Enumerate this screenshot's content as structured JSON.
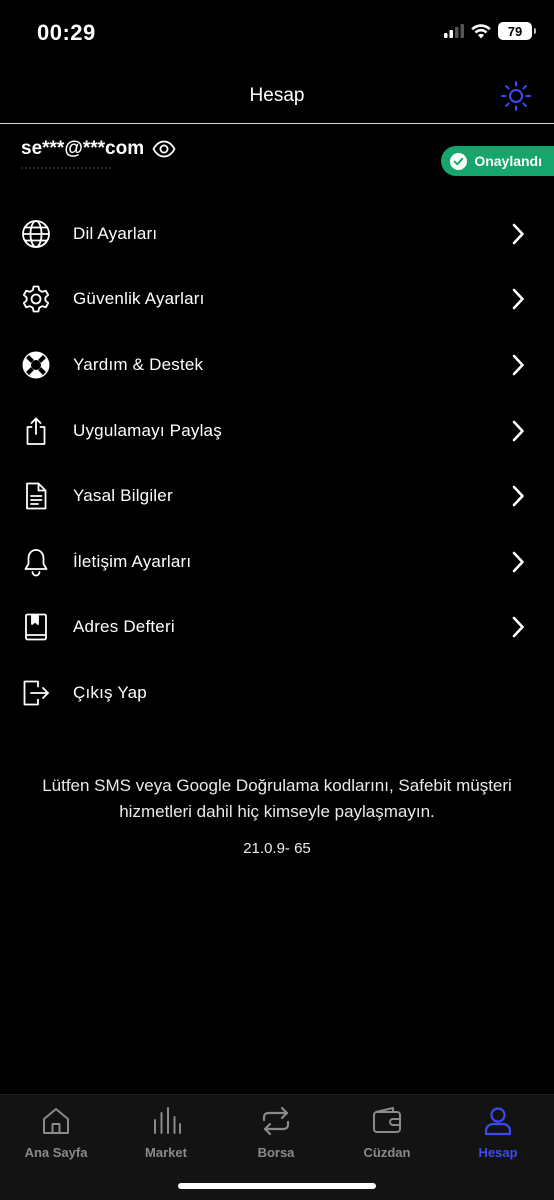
{
  "status": {
    "time": "00:29",
    "battery": "79"
  },
  "header": {
    "title": "Hesap"
  },
  "account": {
    "email": "se***@***com",
    "badge": "Onaylandı"
  },
  "menu": [
    {
      "label": "Dil Ayarları",
      "icon": "globe-icon"
    },
    {
      "label": "Güvenlik Ayarları",
      "icon": "gear-icon"
    },
    {
      "label": "Yardım & Destek",
      "icon": "lifebuoy-icon"
    },
    {
      "label": "Uygulamayı Paylaş",
      "icon": "share-icon"
    },
    {
      "label": "Yasal Bilgiler",
      "icon": "document-icon"
    },
    {
      "label": "İletişim Ayarları",
      "icon": "bell-icon"
    },
    {
      "label": "Adres Defteri",
      "icon": "book-icon"
    },
    {
      "label": "Çıkış Yap",
      "icon": "logout-icon"
    }
  ],
  "footer": {
    "warning": "Lütfen SMS veya Google Doğrulama kodlarını, Safebit müşteri hizmetleri dahil hiç kimseyle paylaşmayın.",
    "version": "21.0.9- 65"
  },
  "tabs": [
    {
      "label": "Ana Sayfa",
      "icon": "home-icon",
      "active": false
    },
    {
      "label": "Market",
      "icon": "chart-bars-icon",
      "active": false
    },
    {
      "label": "Borsa",
      "icon": "swap-icon",
      "active": false
    },
    {
      "label": "Cüzdan",
      "icon": "wallet-icon",
      "active": false
    },
    {
      "label": "Hesap",
      "icon": "user-icon",
      "active": true
    }
  ],
  "colors": {
    "accent": "#3d4af2",
    "success": "#17a56e",
    "inactive": "#8a8a8a"
  }
}
